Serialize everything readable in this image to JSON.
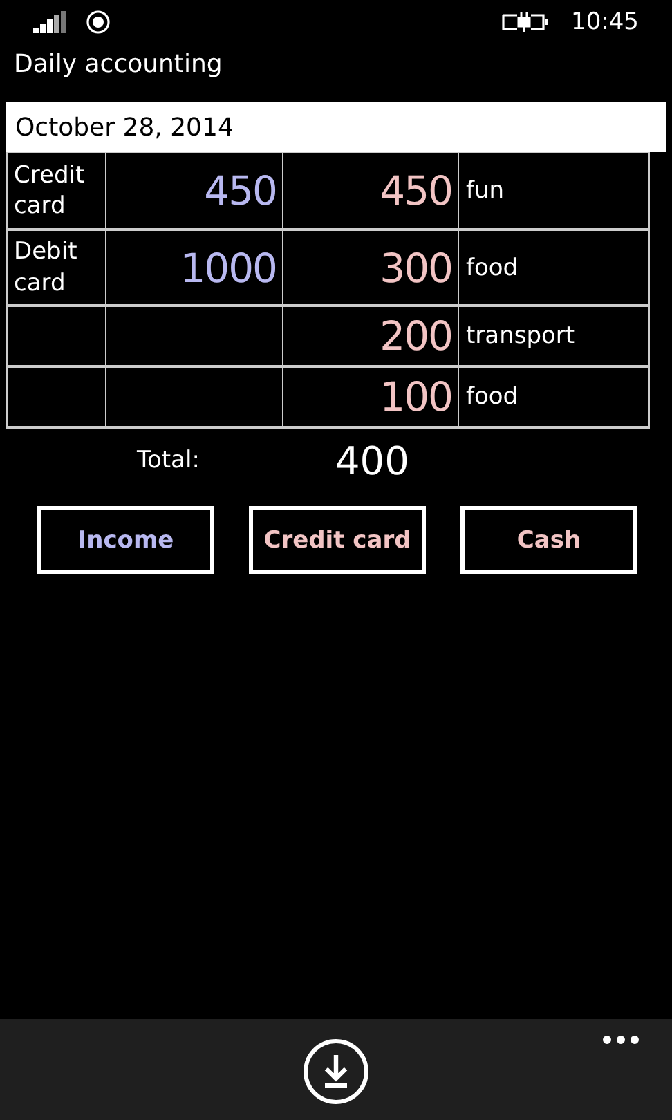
{
  "status_bar": {
    "time": "10:45"
  },
  "app_title": "Daily accounting",
  "date_field": {
    "value": "October 28, 2014"
  },
  "table": {
    "rows": [
      {
        "account": "Credit card",
        "income": "450",
        "expense": "450",
        "category": "fun"
      },
      {
        "account": "Debit card",
        "income": "1000",
        "expense": "300",
        "category": "food"
      },
      {
        "expense": "200",
        "category": "transport"
      },
      {
        "expense": "100",
        "category": "food"
      }
    ]
  },
  "total": {
    "label": "Total:",
    "value": "400"
  },
  "buttons": [
    {
      "label": "Income",
      "kind": "income"
    },
    {
      "label": "Credit card",
      "kind": "expense"
    },
    {
      "label": "Cash",
      "kind": "expense"
    }
  ]
}
